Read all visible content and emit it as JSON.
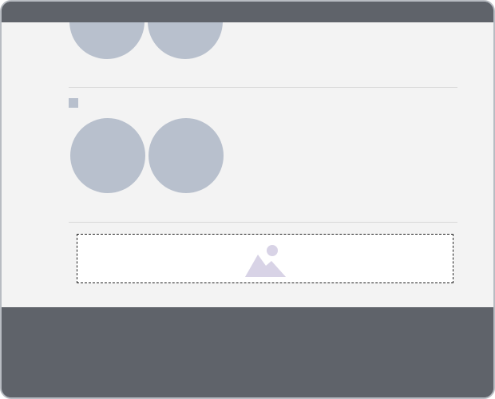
{
  "window": {
    "title": ""
  },
  "sections": [
    {
      "name": "top-avatar-group",
      "avatars": [
        {
          "label": ""
        },
        {
          "label": ""
        }
      ]
    },
    {
      "name": "middle-avatar-group",
      "avatars": [
        {
          "label": ""
        },
        {
          "label": ""
        }
      ]
    }
  ],
  "image_block": {
    "icon": "image-icon"
  },
  "colors": {
    "frame": "#5f636a",
    "content_background": "#f3f3f3",
    "avatar": "#b8c0cd",
    "divider": "#d9d9d9",
    "image_icon": "#d8d3e6"
  }
}
